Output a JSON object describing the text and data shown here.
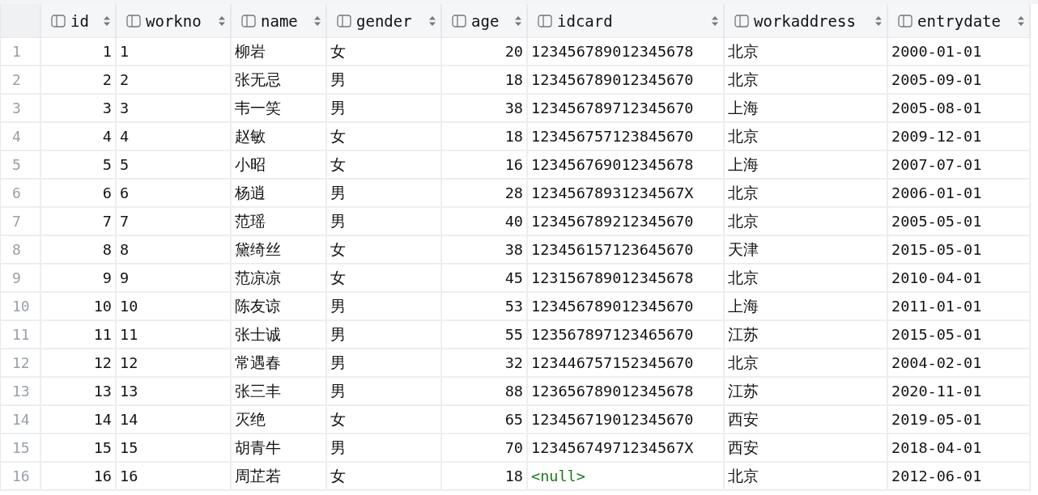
{
  "table": {
    "columns": [
      {
        "name": "id",
        "kind": "number"
      },
      {
        "name": "workno",
        "kind": "text"
      },
      {
        "name": "name",
        "kind": "text"
      },
      {
        "name": "gender",
        "kind": "text"
      },
      {
        "name": "age",
        "kind": "number"
      },
      {
        "name": "idcard",
        "kind": "text"
      },
      {
        "name": "workaddress",
        "kind": "text"
      },
      {
        "name": "entrydate",
        "kind": "text"
      }
    ],
    "rows": [
      {
        "row_number": "1",
        "cells": [
          "1",
          "1",
          "柳岩",
          "女",
          "20",
          "123456789012345678",
          "北京",
          "2000-01-01"
        ]
      },
      {
        "row_number": "2",
        "cells": [
          "2",
          "2",
          "张无忌",
          "男",
          "18",
          "123456789012345670",
          "北京",
          "2005-09-01"
        ]
      },
      {
        "row_number": "3",
        "cells": [
          "3",
          "3",
          "韦一笑",
          "男",
          "38",
          "123456789712345670",
          "上海",
          "2005-08-01"
        ]
      },
      {
        "row_number": "4",
        "cells": [
          "4",
          "4",
          "赵敏",
          "女",
          "18",
          "123456757123845670",
          "北京",
          "2009-12-01"
        ]
      },
      {
        "row_number": "5",
        "cells": [
          "5",
          "5",
          "小昭",
          "女",
          "16",
          "123456769012345678",
          "上海",
          "2007-07-01"
        ]
      },
      {
        "row_number": "6",
        "cells": [
          "6",
          "6",
          "杨逍",
          "男",
          "28",
          "12345678931234567X",
          "北京",
          "2006-01-01"
        ]
      },
      {
        "row_number": "7",
        "cells": [
          "7",
          "7",
          "范瑶",
          "男",
          "40",
          "123456789212345670",
          "北京",
          "2005-05-01"
        ]
      },
      {
        "row_number": "8",
        "cells": [
          "8",
          "8",
          "黛绮丝",
          "女",
          "38",
          "123456157123645670",
          "天津",
          "2015-05-01"
        ]
      },
      {
        "row_number": "9",
        "cells": [
          "9",
          "9",
          "范凉凉",
          "女",
          "45",
          "123156789012345678",
          "北京",
          "2010-04-01"
        ]
      },
      {
        "row_number": "10",
        "cells": [
          "10",
          "10",
          "陈友谅",
          "男",
          "53",
          "123456789012345670",
          "上海",
          "2011-01-01"
        ]
      },
      {
        "row_number": "11",
        "cells": [
          "11",
          "11",
          "张士诚",
          "男",
          "55",
          "123567897123465670",
          "江苏",
          "2015-05-01"
        ]
      },
      {
        "row_number": "12",
        "cells": [
          "12",
          "12",
          "常遇春",
          "男",
          "32",
          "123446757152345670",
          "北京",
          "2004-02-01"
        ]
      },
      {
        "row_number": "13",
        "cells": [
          "13",
          "13",
          "张三丰",
          "男",
          "88",
          "123656789012345678",
          "江苏",
          "2020-11-01"
        ]
      },
      {
        "row_number": "14",
        "cells": [
          "14",
          "14",
          "灭绝",
          "女",
          "65",
          "123456719012345670",
          "西安",
          "2019-05-01"
        ]
      },
      {
        "row_number": "15",
        "cells": [
          "15",
          "15",
          "胡青牛",
          "男",
          "70",
          "12345674971234567X",
          "西安",
          "2018-04-01"
        ]
      },
      {
        "row_number": "16",
        "cells": [
          "16",
          "16",
          "周芷若",
          "女",
          "18",
          {
            "kind": "null",
            "text": "<null>"
          },
          "北京",
          "2012-06-01"
        ]
      }
    ]
  }
}
